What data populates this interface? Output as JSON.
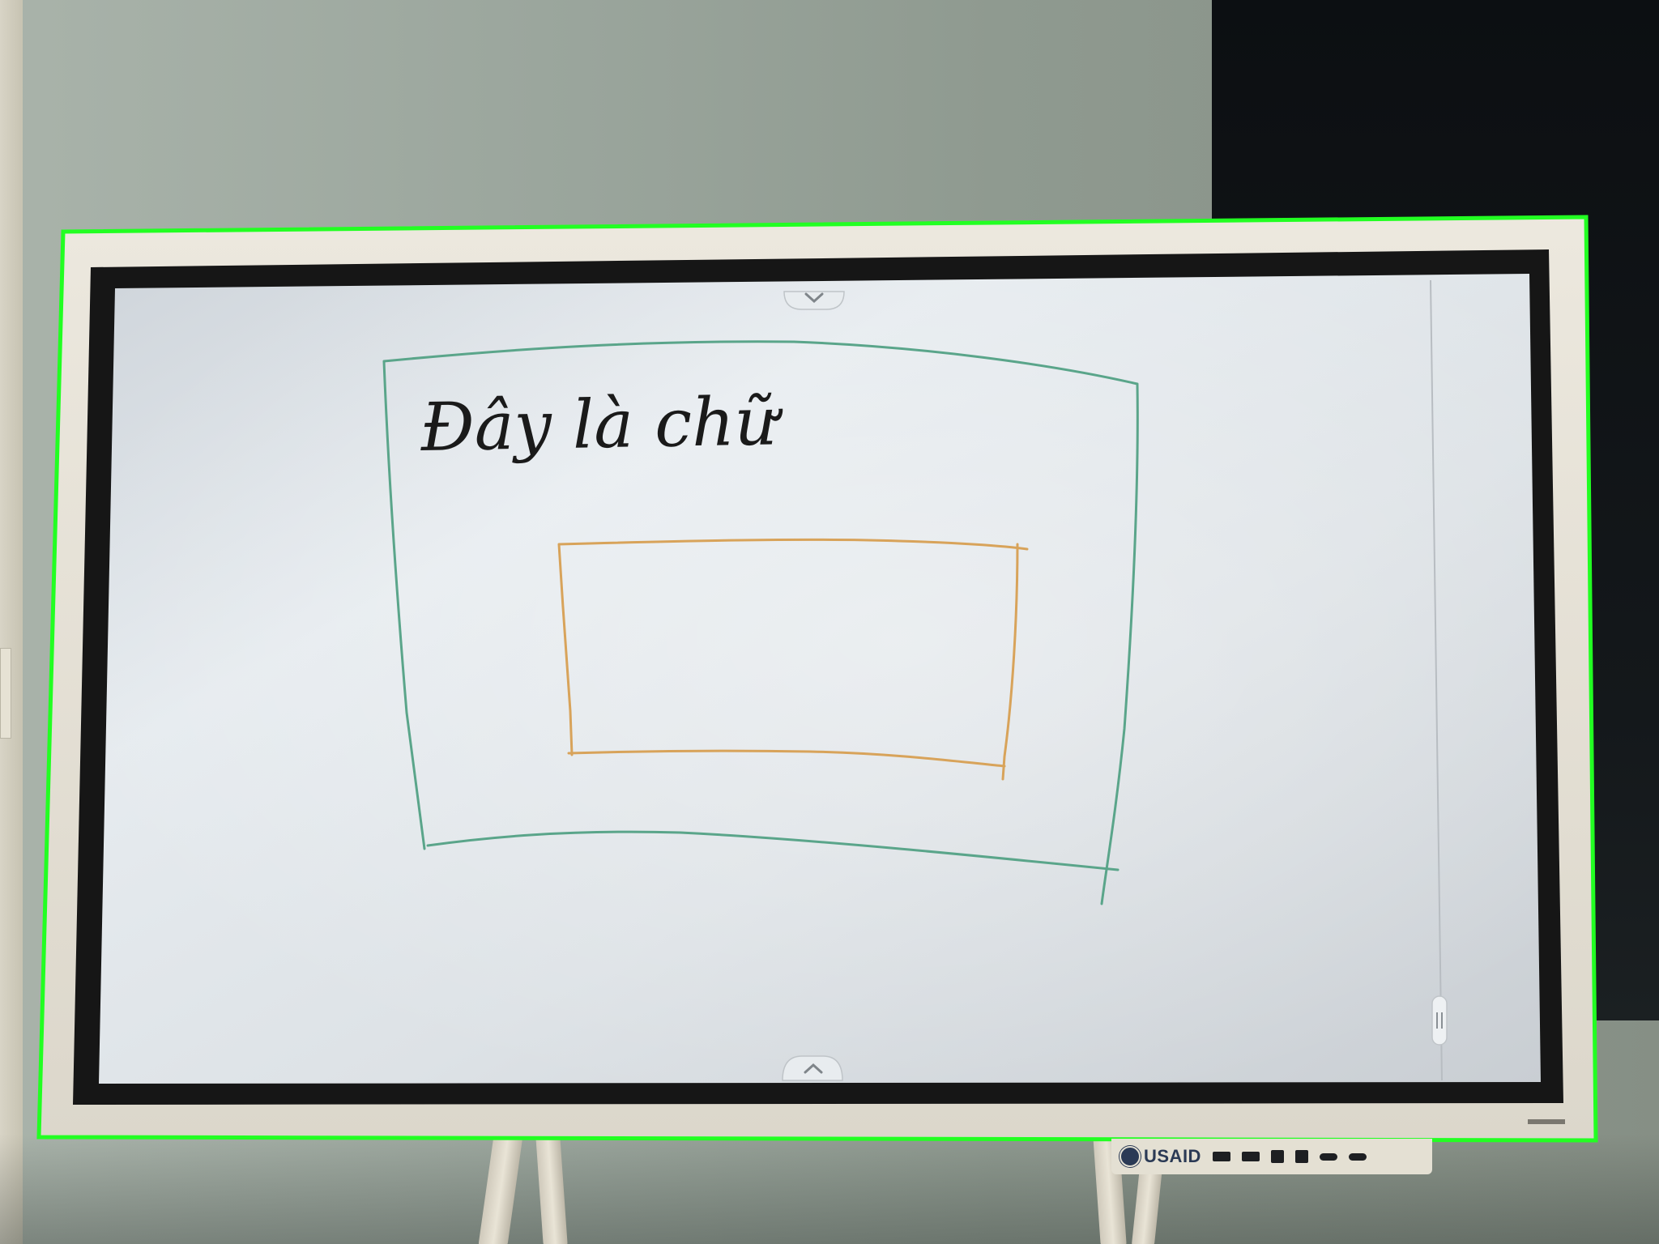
{
  "scene": {
    "description_type": "photo of a digital whiteboard display on a stand",
    "board_text": "Đây là chữ",
    "sticker_label": "USAID",
    "colors": {
      "outer_frame": "#e8e4da",
      "bezel": "#161616",
      "screen": "#d9dee3",
      "outer_rectangle_stroke": "#5aa58a",
      "inner_rectangle_stroke": "#d8a35a",
      "handwriting": "#1a1a1a",
      "highlight_outline": "#22ff22"
    },
    "icons": [
      "chevron-down-icon",
      "chevron-up-icon",
      "side-handle-icon"
    ]
  }
}
